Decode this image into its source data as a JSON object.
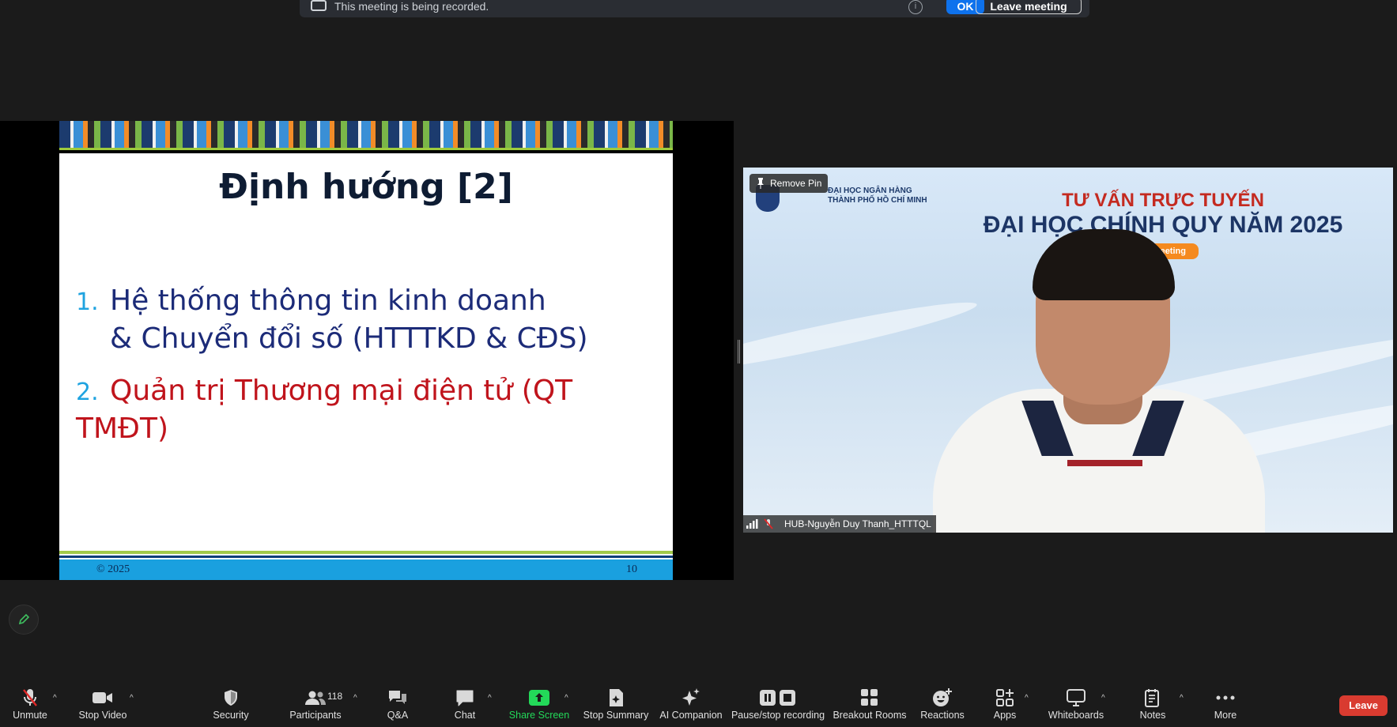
{
  "recording_banner": {
    "message": "This meeting is being recorded.",
    "info_icon": "info-icon",
    "ok_label": "OK",
    "leave_label": "Leave meeting"
  },
  "slide": {
    "title": "Định hướng [2]",
    "items": [
      {
        "number": "1.",
        "line1": "Hệ thống thông tin kinh doanh",
        "line2": "& Chuyển đổi số (HTTTKD & CĐS)",
        "color": "#1c2b78"
      },
      {
        "number": "2.",
        "line1": "Quản trị Thương mại điện tử (QT TMĐT)",
        "color": "#c0141c"
      }
    ],
    "footer_copyright": "© 2025",
    "page_number": "10"
  },
  "video": {
    "remove_pin_label": "Remove Pin",
    "logo_line1": "ĐẠI HỌC NGÂN HÀNG",
    "logo_line2": "THÀNH PHỐ HỒ CHÍ MINH",
    "headline1": "TƯ VẤN TRỰC TUYẾN",
    "headline2": "ĐẠI HỌC CHÍNH QUY NĂM 2025",
    "badge": "zoom meeting",
    "participant_name": "HUB-Nguyễn Duy Thanh_HTTTQL"
  },
  "toolbar": {
    "items": [
      {
        "id": "unmute",
        "label": "Unmute",
        "icon": "mic-muted-icon"
      },
      {
        "id": "stop-video",
        "label": "Stop Video",
        "icon": "video-camera-icon"
      },
      {
        "id": "security",
        "label": "Security",
        "icon": "shield-icon"
      },
      {
        "id": "participants",
        "label": "Participants",
        "icon": "participants-icon",
        "count": "118"
      },
      {
        "id": "qa",
        "label": "Q&A",
        "icon": "qa-icon"
      },
      {
        "id": "chat",
        "label": "Chat",
        "icon": "chat-icon"
      },
      {
        "id": "share-screen",
        "label": "Share Screen",
        "icon": "share-screen-icon",
        "color": "#23d959"
      },
      {
        "id": "stop-summary",
        "label": "Stop Summary",
        "icon": "summary-icon"
      },
      {
        "id": "ai-companion",
        "label": "AI Companion",
        "icon": "ai-sparkle-icon"
      },
      {
        "id": "pause-stop-recording",
        "label": "Pause/stop recording",
        "icon": "pause-stop-icon"
      },
      {
        "id": "breakout-rooms",
        "label": "Breakout Rooms",
        "icon": "breakout-grid-icon"
      },
      {
        "id": "reactions",
        "label": "Reactions",
        "icon": "emoji-plus-icon"
      },
      {
        "id": "apps",
        "label": "Apps",
        "icon": "apps-icon"
      },
      {
        "id": "whiteboards",
        "label": "Whiteboards",
        "icon": "whiteboard-icon"
      },
      {
        "id": "notes",
        "label": "Notes",
        "icon": "notes-icon"
      },
      {
        "id": "more",
        "label": "More",
        "icon": "more-dots-icon"
      }
    ],
    "leave_label": "Leave",
    "leave_color": "#d93b30"
  }
}
